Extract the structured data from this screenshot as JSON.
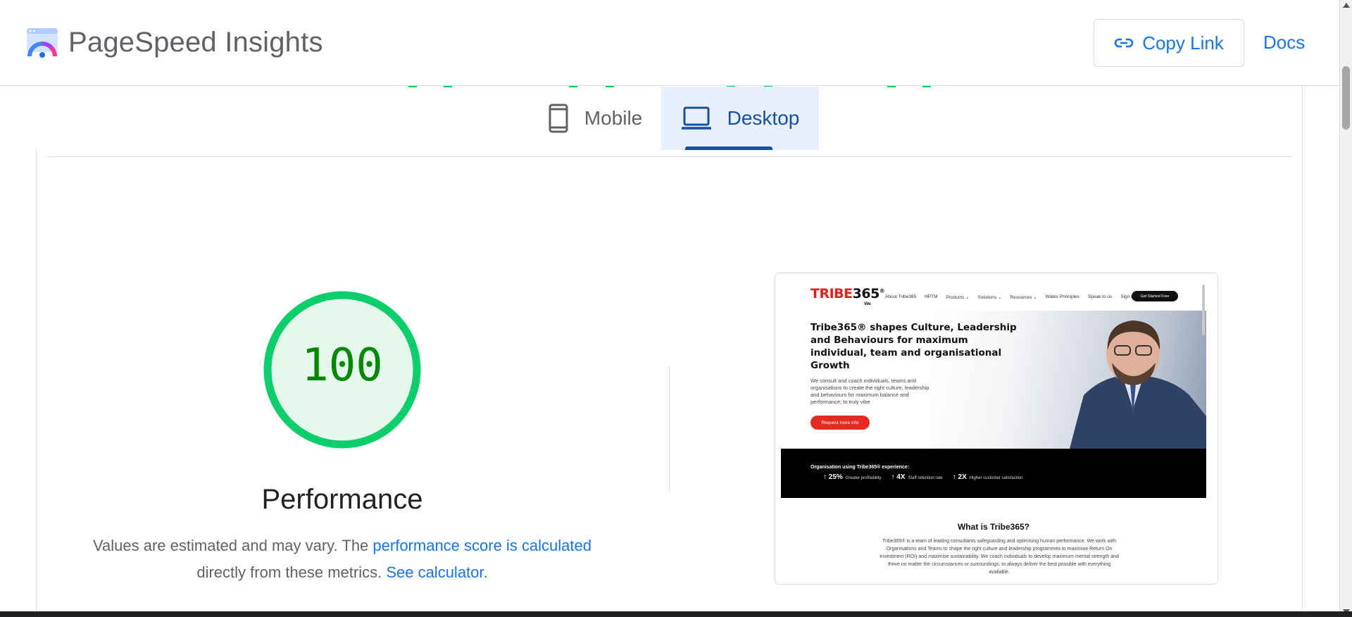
{
  "header": {
    "brand": "PageSpeed Insights",
    "copy_link_label": "Copy Link",
    "docs_label": "Docs"
  },
  "tabs": [
    {
      "label": "Mobile",
      "icon": "smartphone-icon",
      "selected": false
    },
    {
      "label": "Desktop",
      "icon": "laptop-icon",
      "selected": true
    }
  ],
  "score": {
    "value": "100",
    "category": "Performance",
    "color": "#0cce6b"
  },
  "note": {
    "text_before": "Values are estimated and may vary. The ",
    "link1": "performance score is calculated",
    "text_middle": " directly from these metrics. ",
    "link2": "See calculator",
    "text_after": "."
  },
  "preview": {
    "logo_red": "TRIBE",
    "logo_black": "365",
    "logo_mark": "®",
    "logo_sub": "We",
    "nav": [
      "About Tribe365",
      "HPTM",
      "Products ⌄",
      "Solutions ⌄",
      "Resources ⌄",
      "Wates Principles",
      "Speak to us",
      "Sign in"
    ],
    "cta": "Get Started Free",
    "hero_title": "Tribe365® shapes Culture, Leadership and Behaviours for maximum individual, team and organisational Growth",
    "hero_desc": "We consult and coach individuals, teams and organisations to create the right culture, leadership and behaviours for maximum balance and performance; to truly vibe",
    "hero_button": "Request more info",
    "band_title": "Organisation using Tribe365® experience:",
    "stats": [
      {
        "value": "25%",
        "label": "Greater profitability"
      },
      {
        "value": "4X",
        "label": "Staff retention rate"
      },
      {
        "value": "2X",
        "label": "Higher customer satisfaction"
      }
    ],
    "section_title": "What is Tribe365?",
    "section_text": "Tribe365® is a team of leading consultants safeguarding and optimising human performance. We work with Organisations and Teams to shape the right culture and leadership programmes to maximise Return On Investment (ROI) and maximise sustainability. We coach individuals to develop maximum mental strength and thrive no matter the circumstances or surroundings; to always deliver the best possible with everything available."
  }
}
